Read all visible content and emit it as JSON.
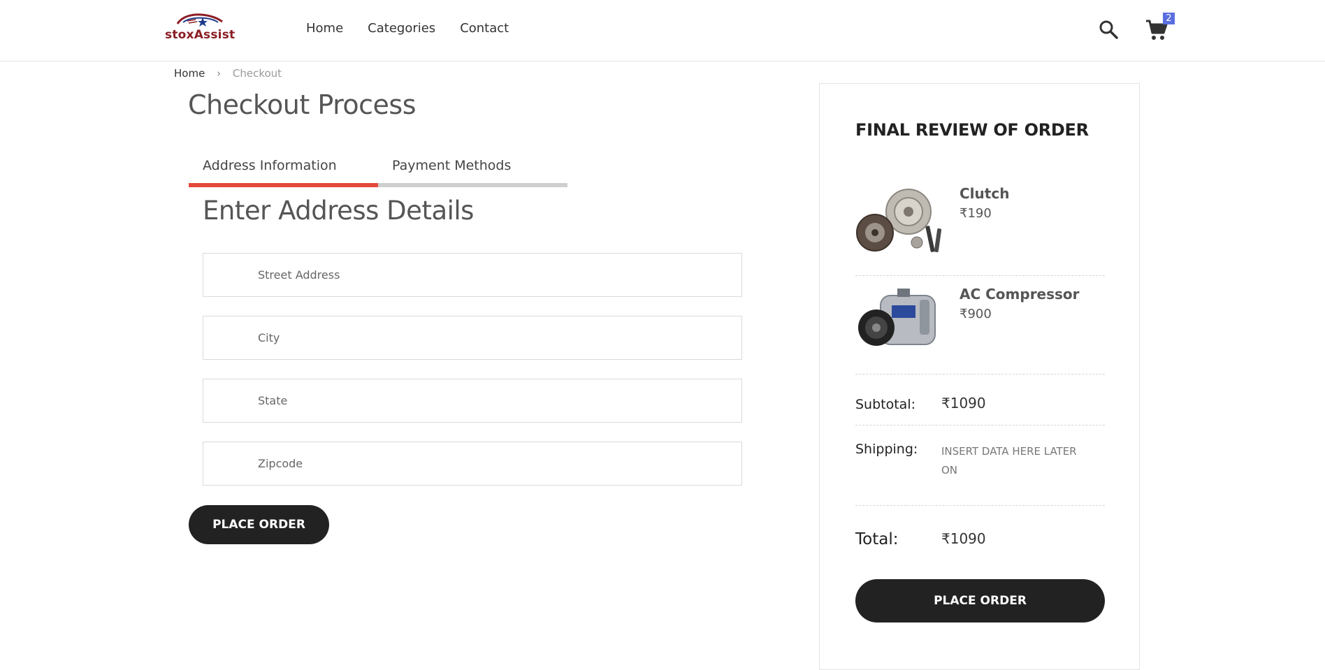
{
  "brand": {
    "name": "stoxAssist",
    "accent": "#8b1d24"
  },
  "nav": {
    "home": "Home",
    "categories": "Categories",
    "contact": "Contact"
  },
  "header": {
    "cart_count": "2",
    "search_icon": "search-icon",
    "cart_icon": "cart-icon"
  },
  "breadcrumb": {
    "home": "Home",
    "separator": "›",
    "current": "Checkout"
  },
  "checkout": {
    "title": "Checkout Process",
    "tabs": [
      {
        "label": "Address Information",
        "active": true
      },
      {
        "label": "Payment Methods",
        "active": false
      }
    ],
    "section_title": "Enter Address Details",
    "fields": {
      "street": {
        "placeholder": "Street Address",
        "value": ""
      },
      "city": {
        "placeholder": "City",
        "value": ""
      },
      "state": {
        "placeholder": "State",
        "value": ""
      },
      "zipcode": {
        "placeholder": "Zipcode",
        "value": ""
      }
    },
    "place_order": "PLACE ORDER"
  },
  "summary": {
    "title": "FINAL REVIEW OF ORDER",
    "items": [
      {
        "name": "Clutch",
        "price": "₹190"
      },
      {
        "name": "AC Compressor",
        "price": "₹900"
      }
    ],
    "subtotal_label": "Subtotal:",
    "subtotal_value": "₹1090",
    "shipping_label": "Shipping:",
    "shipping_value": "INSERT DATA HERE LATER ON",
    "total_label": "Total:",
    "total_value": "₹1090",
    "place_order": "PLACE ORDER"
  },
  "colors": {
    "tab_active": "#e54a3d",
    "tab_inactive": "#cfcfcf",
    "button": "#222222",
    "badge": "#5b6ee1"
  }
}
